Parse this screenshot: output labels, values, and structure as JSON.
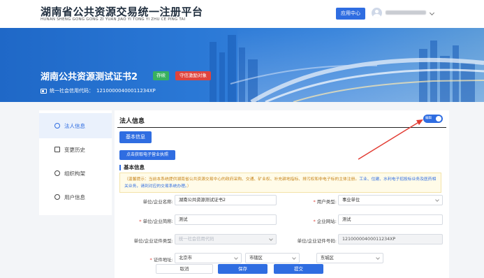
{
  "header": {
    "brand_cn": "湖南省公共资源交易统一注册平台",
    "brand_en": "HUNAN SHENG GONG GONG ZI YUAN JIAO YI TONG YI ZHU CE PING TAI",
    "app_center_label": "应用中心"
  },
  "banner": {
    "cert_title": "湖南公共资源测试证书2",
    "status_tag": "存续",
    "credit_tag": "守信激励对象",
    "credit_code_label": "统一社会信用代码：",
    "credit_code_value": "12100000400011234XP"
  },
  "sidenav": {
    "items": [
      {
        "label": "法人信息",
        "icon": "person-icon",
        "active": true
      },
      {
        "label": "变更历史",
        "icon": "history-icon",
        "active": false
      },
      {
        "label": "组织构架",
        "icon": "org-icon",
        "active": false
      },
      {
        "label": "用户信息",
        "icon": "user-icon",
        "active": false
      }
    ]
  },
  "main": {
    "title": "法人信息",
    "toggle_label": "编辑",
    "tab_basic": "基本信息",
    "fetch_license_button": "点击获取电子营业执照",
    "section_title": "基本信息",
    "notice_text": "（温馨提示：当前本系统提供湖南省公共资源交易中心的政府采购、交通、矿业权、补充耕地指标、排污权和非电子标的主体注册。",
    "notice_link": "工业、住建、水利电子招投标业务及医药相关业务，请到对应的交易系统办理。",
    "notice_end": "）"
  },
  "form": {
    "org_name_label": "单位/企业名称:",
    "org_name_value": "湖南公共资源测试证书2",
    "user_type_label": "用户类型:",
    "user_type_value": "事业单位",
    "short_name_label": "单位/企业简称:",
    "short_name_value": "测试",
    "website_label": "企业网站:",
    "website_value": "测试",
    "cert_type_label": "单位/企业证件类型:",
    "cert_type_value": "统一社会信用代码",
    "cert_no_label": "单位/企业证件号码:",
    "cert_no_value": "12100000400011234XP",
    "address_label": "证件地址:",
    "province_value": "北京市",
    "city_value": "市辖区",
    "district_value": "东城区"
  },
  "actions": {
    "cancel": "取消",
    "save": "保存",
    "submit": "提交"
  },
  "colors": {
    "accent": "#2f6de1",
    "status_green": "#38b15f",
    "status_red": "#e0443d",
    "annotation_arrow": "#e23b32"
  }
}
